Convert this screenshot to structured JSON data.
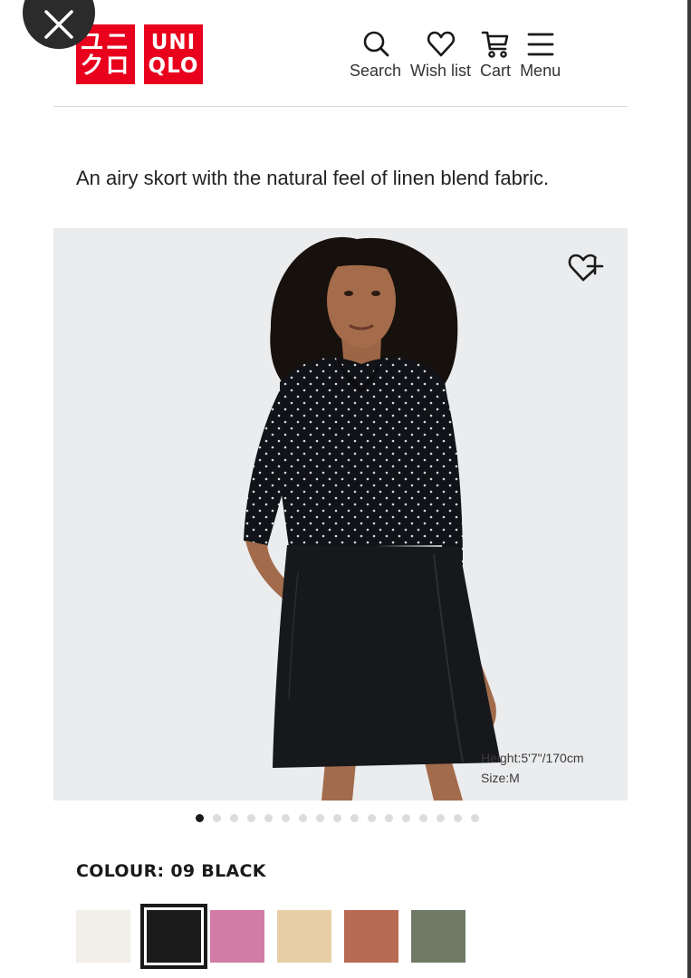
{
  "brand": {
    "logo_katakana_line1": "ユニ",
    "logo_katakana_line2": "クロ",
    "logo_latin_line1": "UNI",
    "logo_latin_line2": "QLO",
    "color": "#e8001d"
  },
  "nav": {
    "items": [
      {
        "label": "Search",
        "icon": "search-icon"
      },
      {
        "label": "Wish list",
        "icon": "heart-icon"
      },
      {
        "label": "Cart",
        "icon": "cart-icon"
      },
      {
        "label": "Menu",
        "icon": "menu-icon"
      }
    ]
  },
  "product": {
    "description": "An airy skort with the natural feel of linen blend fabric.",
    "model_height": "Height:5'7\"/170cm",
    "model_size": "Size:M"
  },
  "gallery": {
    "image_count": 17,
    "active_index": 0
  },
  "colour": {
    "label": "COLOUR: 09 BLACK",
    "selected_index": 1,
    "swatches": [
      "#f2eee8",
      "#1b1b1b",
      "#d17ca6",
      "#e8cfa6",
      "#b86a52",
      "#6e7a66"
    ]
  }
}
